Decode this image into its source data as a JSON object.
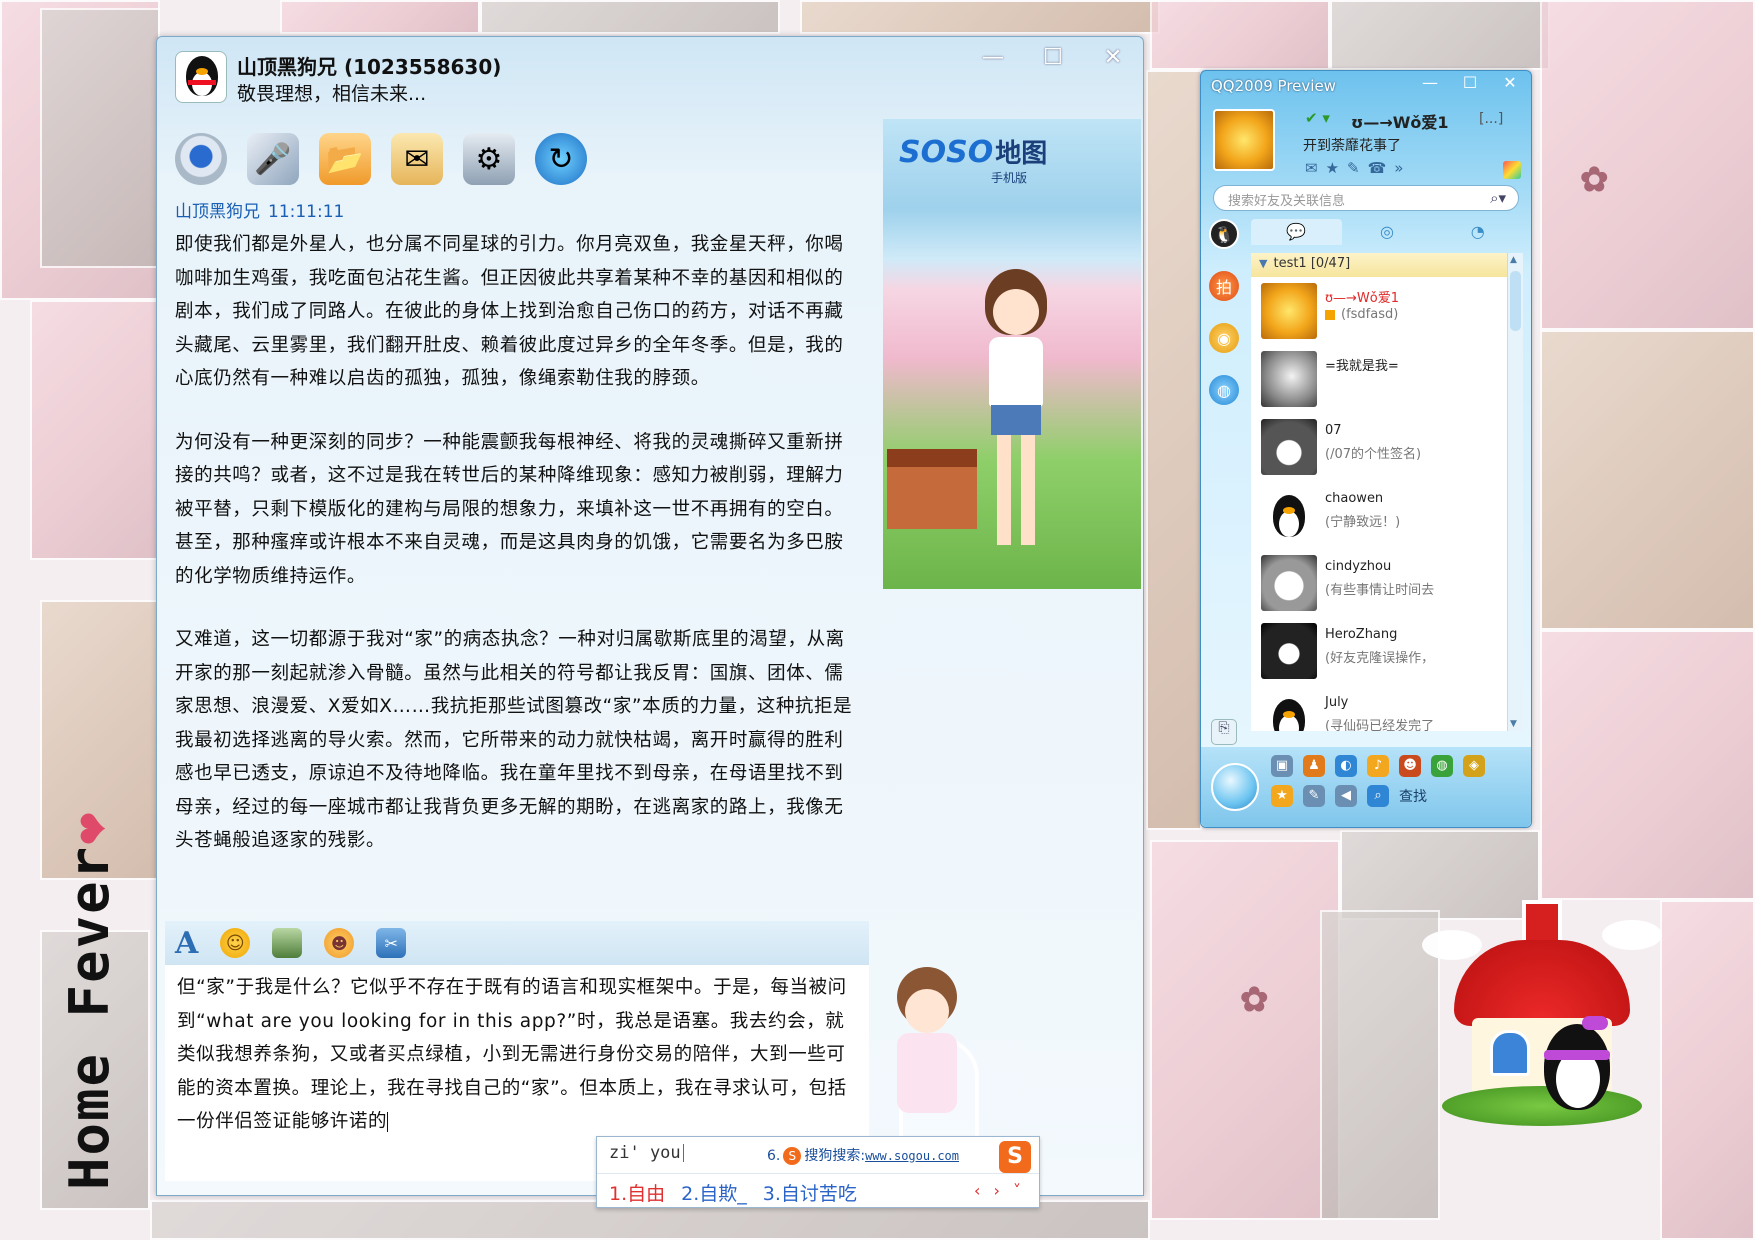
{
  "wallpaper": {
    "caption": "Home Fever",
    "caption_heart": "❤"
  },
  "chat_window": {
    "contact_name": "山顶黑狗兄 (1023558630)",
    "contact_motto": "敬畏理想，相信未来...",
    "window_controls": [
      "—",
      "☐",
      "✕"
    ],
    "toolbar_icons": [
      "video-call",
      "voice-call",
      "send-file",
      "send-email",
      "application",
      "share-web"
    ],
    "message": {
      "sender": "山顶黑狗兄",
      "time": "11:11:11",
      "paragraphs": [
        "即使我们都是外星人，也分属不同星球的引力。你月亮双鱼，我金星天秤，你喝咖啡加生鸡蛋，我吃面包沾花生酱。但正因彼此共享着某种不幸的基因和相似的剧本，我们成了同路人。在彼此的身体上找到治愈自己伤口的药方，对话不再藏头藏尾、云里雾里，我们翻开肚皮、赖着彼此度过异乡的全年冬季。但是，我的心底仍然有一种难以启齿的孤独，孤独，像绳索勒住我的脖颈。",
        "为何没有一种更深刻的同步？一种能震颤我每根神经、将我的灵魂撕碎又重新拼接的共鸣？或者，这不过是我在转世后的某种降维现象：感知力被削弱，理解力被平替，只剩下模版化的建构与局限的想象力，来填补这一世不再拥有的空白。甚至，那种瘙痒或许根本不来自灵魂，而是这具肉身的饥饿，它需要名为多巴胺的化学物质维持运作。",
        "又难道，这一切都源于我对“家”的病态执念？一种对归属歇斯底里的渴望，从离开家的那一刻起就渗入骨髓。虽然与此相关的符号都让我反胃：国旗、团体、儒家思想、浪漫爱、X爱如X……我抗拒那些试图篡改“家”本质的力量，这种抗拒是我最初选择逃离的导火索。然而，它所带来的动力就快枯竭，离开时赢得的胜利感也早已透支，原谅迫不及待地降临。我在童年里找不到母亲，在母语里找不到母亲，经过的每一座城市都让我背负更多无解的期盼，在逃离家的路上，我像无头苍蝇般追逐家的残影。"
      ]
    },
    "format_toolbar": [
      "font-A",
      "emoticon",
      "image",
      "magic-face",
      "screenshot"
    ],
    "input_text": "但“家”于我是什么？它似乎不存在于既有的语言和现实框架中。于是，每当被问到“what are you looking for in this app?”时，我总是语塞。我去约会，就类似我想养条狗，又或者买点绿植，小到无需进行身份交易的陪伴，大到一些可能的资本置换。理论上，我在寻找自己的“家”。但本质上，我在寻求认可，包括一份伴侣签证能够许诺的",
    "side_ad": {
      "brand": "SOSO",
      "brand_suffix": "地图",
      "sub": "手机版"
    }
  },
  "ime": {
    "pinyin": "zi' you",
    "sogou_label": "6.",
    "sogou_search": "搜狗搜索:",
    "sogou_url": "www.sogou.com",
    "candidates": [
      {
        "label": "1.自由",
        "selected": true
      },
      {
        "label": "2.自欺_",
        "selected": false
      },
      {
        "label": "3.自讨苦吃",
        "selected": false
      }
    ],
    "nav": "‹ › ˅",
    "logo": "S"
  },
  "qq_panel": {
    "title": "QQ2009 Preview",
    "window_controls": [
      "—",
      "☐",
      "✕"
    ],
    "status_icon": "✔ ▾",
    "nickname": "ʊ—→Wǒ爱1",
    "nickname_more": "[...]",
    "signature": "开到荼靡花事了",
    "quick_icons": [
      "✉",
      "★",
      "✎",
      "☎",
      "»"
    ],
    "search_placeholder": "搜索好友及关联信息",
    "tabs": [
      "💬",
      "◎",
      "◔"
    ],
    "group": {
      "name": "test1 [0/47]"
    },
    "buddies": [
      {
        "name": "ʊ—→Wǒ爱1",
        "signature": "(fsdfasd)",
        "avatar": "sun",
        "highlight": true,
        "mini_icon": true
      },
      {
        "name": "=我就是我=",
        "signature": "",
        "avatar": "gray",
        "highlight": false,
        "mini_icon": false
      },
      {
        "name": "07",
        "signature": "(/07的个性签名)",
        "avatar": "anime",
        "highlight": false,
        "mini_icon": false
      },
      {
        "name": "chaowen",
        "signature": "(宁静致远！)",
        "avatar": "penguin",
        "highlight": false,
        "mini_icon": false
      },
      {
        "name": "cindyzhou",
        "signature": "(有些事情让时间去",
        "avatar": "girl",
        "highlight": false,
        "mini_icon": false
      },
      {
        "name": "HeroZhang",
        "signature": "(好友克隆误操作，",
        "avatar": "hero",
        "highlight": false,
        "mini_icon": false
      },
      {
        "name": "July",
        "signature": "(寻仙码已经发完了",
        "avatar": "penguin",
        "highlight": false,
        "mini_icon": false
      }
    ],
    "bottom_find_label": "查找"
  }
}
